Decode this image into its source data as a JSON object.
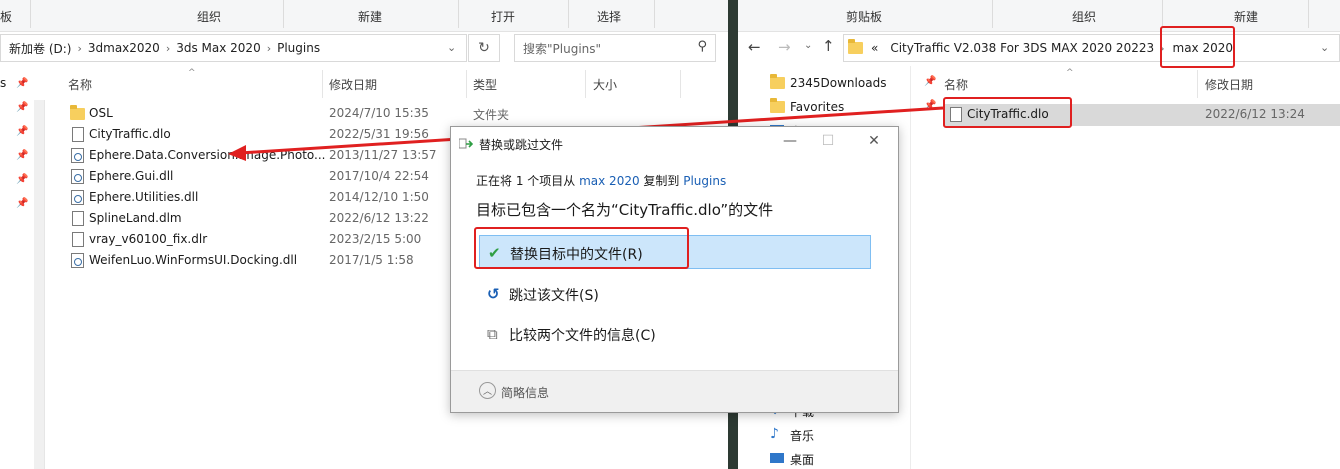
{
  "left_explorer": {
    "ribbon": [
      "板",
      "组织",
      "新建",
      "打开",
      "选择"
    ],
    "breadcrumb": [
      "新加卷 (D:)",
      "3dmax2020",
      "3ds Max 2020",
      "Plugins"
    ],
    "search_placeholder": "搜索\"Plugins\"",
    "nav_stub": "s",
    "columns": {
      "name": "名称",
      "date": "修改日期",
      "type": "类型",
      "size": "大小"
    },
    "files": [
      {
        "name": "OSL",
        "date": "2024/7/10 15:35",
        "type": "文件夹",
        "icon": "folder-icon"
      },
      {
        "name": "CityTraffic.dlo",
        "date": "2022/5/31 19:56",
        "type": "",
        "icon": "file-icon"
      },
      {
        "name": "Ephere.Data.Conversion.Image.Photo...",
        "date": "2013/11/27 13:57",
        "type": "",
        "icon": "dll-icon"
      },
      {
        "name": "Ephere.Gui.dll",
        "date": "2017/10/4 22:54",
        "type": "",
        "icon": "dll-icon"
      },
      {
        "name": "Ephere.Utilities.dll",
        "date": "2014/12/10 1:50",
        "type": "",
        "icon": "dll-icon"
      },
      {
        "name": "SplineLand.dlm",
        "date": "2022/6/12 13:22",
        "type": "",
        "icon": "file-icon"
      },
      {
        "name": "vray_v60100_fix.dlr",
        "date": "2023/2/15 5:00",
        "type": "",
        "icon": "file-icon"
      },
      {
        "name": "WeifenLuo.WinFormsUI.Docking.dll",
        "date": "2017/1/5 1:58",
        "type": "",
        "icon": "dll-icon"
      }
    ]
  },
  "right_explorer": {
    "ribbon": [
      "剪贴板",
      "组织",
      "新建"
    ],
    "breadcrumb": [
      "«",
      "CityTraffic V2.038 For 3DS MAX 2020 20223",
      "max 2020"
    ],
    "columns": {
      "name": "名称",
      "date": "修改日期"
    },
    "nav": [
      {
        "label": "2345Downloads",
        "icon": "folder-icon"
      },
      {
        "label": "Favorites",
        "icon": "folder-icon"
      },
      {
        "label": "桌面",
        "icon": "desktop-icon"
      },
      {
        "label": "下载",
        "icon": "download-icon"
      },
      {
        "label": "音乐",
        "icon": "music-icon"
      },
      {
        "label": "桌面",
        "icon": "desktop-icon"
      }
    ],
    "files": [
      {
        "name": "CityTraffic.dlo",
        "date": "2022/6/12 13:24"
      }
    ]
  },
  "dialog": {
    "title": "替换或跳过文件",
    "progress_prefix": "正在将 1 个项目从 ",
    "progress_source": "max 2020",
    "progress_middle": " 复制到 ",
    "progress_target": "Plugins",
    "heading": "目标已包含一个名为“CityTraffic.dlo”的文件",
    "options": [
      {
        "label": "替换目标中的文件(R)",
        "icon": "checkmark-icon"
      },
      {
        "label": "跳过该文件(S)",
        "icon": "skip-icon"
      },
      {
        "label": "比较两个文件的信息(C)",
        "icon": "compare-icon"
      }
    ],
    "details_label": "简略信息"
  },
  "colors": {
    "highlight": "#cce6fb",
    "annotation_red": "#e02020",
    "link": "#1a5fb4"
  }
}
